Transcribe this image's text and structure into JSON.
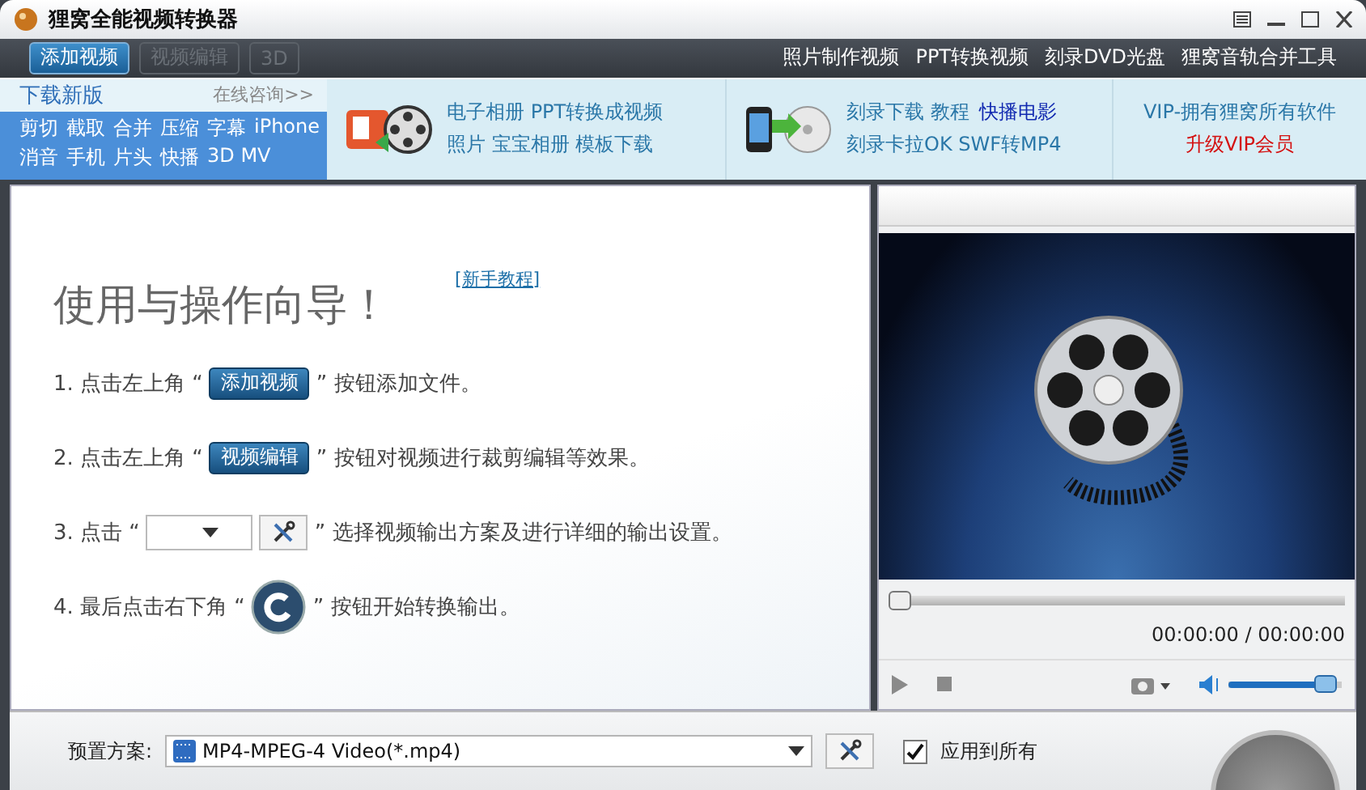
{
  "window": {
    "title": "狸窝全能视频转换器"
  },
  "toolbar": {
    "buttons": [
      {
        "label": "添加视频",
        "disabled": false
      },
      {
        "label": "视频编辑",
        "disabled": true
      },
      {
        "label": "3D",
        "disabled": true
      }
    ],
    "links": [
      "照片制作视频",
      "PPT转换视频",
      "刻录DVD光盘",
      "狸窝音轨合并工具"
    ]
  },
  "banner": {
    "download": "下载新版",
    "consult": "在线咨询>>",
    "tag_rows": [
      {
        "tags": [
          "剪切",
          "截取",
          "合并",
          "压缩",
          "字幕",
          "iPhone"
        ]
      },
      {
        "tags": [
          "消音",
          "手机",
          "片头",
          "快播",
          "3D MV"
        ]
      }
    ],
    "promo_ppt": {
      "lines": [
        "电子相册 PPT转换成视频",
        "照片 宝宝相册 模板下载"
      ]
    },
    "promo_dvd": {
      "lines": [
        {
          "links": [
            {
              "text": "刻录下载 教程",
              "strong": false
            },
            {
              "text": "快播电影",
              "strong": true
            }
          ]
        },
        {
          "links": [
            {
              "text": "刻录卡拉OK SWF转MP4",
              "strong": false
            }
          ]
        }
      ]
    },
    "vip": {
      "line_1": "VIP-拥有狸窝所有软件",
      "line_2": "升级VIP会员"
    }
  },
  "guide": {
    "title": "使用与操作向导！",
    "tutorial_link": "[新手教程]",
    "steps": [
      {
        "kind": "button",
        "prefix": "1. 点击左上角 “",
        "button": "添加视频",
        "suffix": "” 按钮添加文件。"
      },
      {
        "kind": "button",
        "prefix": "2. 点击左上角 “",
        "button": "视频编辑",
        "suffix": "” 按钮对视频进行裁剪编辑等效果。"
      },
      {
        "kind": "select",
        "prefix": "3. 点击 “",
        "suffix": "” 选择视频输出方案及进行详细的输出设置。"
      },
      {
        "kind": "convert",
        "prefix": "4. 最后点击右下角 “",
        "suffix": "” 按钮开始转换输出。"
      }
    ]
  },
  "player": {
    "progress": {
      "level": 0
    },
    "time": "00:00:00 / 00:00:00",
    "volume": {
      "level": 0.95
    }
  },
  "bottom": {
    "preset_label": "预置方案:",
    "preset_value": "MP4-MPEG-4 Video(*.mp4)",
    "apply_all": {
      "label": "应用到所有",
      "checked": true
    }
  }
}
